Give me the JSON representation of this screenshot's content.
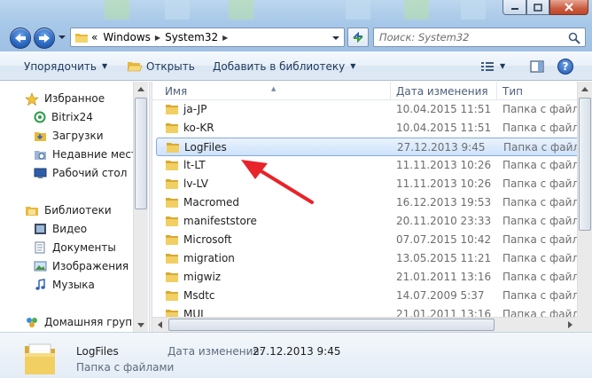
{
  "window": {
    "controls": {
      "minimize": "minimize",
      "maximize": "maximize",
      "close": "close"
    }
  },
  "address": {
    "overflow": "«",
    "crumbs": [
      "Windows",
      "System32"
    ]
  },
  "search": {
    "placeholder": "Поиск: System32"
  },
  "toolbar": {
    "organize": "Упорядочить",
    "open": "Открыть",
    "add_to_library": "Добавить в библиотеку"
  },
  "sidebar": {
    "favorites": {
      "label": "Избранное",
      "items": [
        "Bitrix24",
        "Загрузки",
        "Недавние места",
        "Рабочий стол"
      ]
    },
    "libraries": {
      "label": "Библиотеки",
      "items": [
        "Видео",
        "Документы",
        "Изображения",
        "Музыка"
      ]
    },
    "homegroup": {
      "label": "Домашняя группа"
    }
  },
  "columns": {
    "name": "Имя",
    "date": "Дата изменения",
    "type": "Тип"
  },
  "files": [
    {
      "name": "ja-JP",
      "date": "10.04.2015 11:51",
      "type": "Папка с файлами"
    },
    {
      "name": "ko-KR",
      "date": "10.04.2015 11:51",
      "type": "Папка с файлами"
    },
    {
      "name": "LogFiles",
      "date": "27.12.2013 9:45",
      "type": "Папка с файлами"
    },
    {
      "name": "lt-LT",
      "date": "11.11.2013 10:26",
      "type": "Папка с файлами"
    },
    {
      "name": "lv-LV",
      "date": "11.11.2013 10:26",
      "type": "Папка с файлами"
    },
    {
      "name": "Macromed",
      "date": "16.12.2013 19:53",
      "type": "Папка с файлами"
    },
    {
      "name": "manifeststore",
      "date": "20.11.2010 23:33",
      "type": "Папка с файлами"
    },
    {
      "name": "Microsoft",
      "date": "07.07.2015 10:42",
      "type": "Папка с файлами"
    },
    {
      "name": "migration",
      "date": "13.05.2015 11:21",
      "type": "Папка с файлами"
    },
    {
      "name": "migwiz",
      "date": "21.01.2011 13:16",
      "type": "Папка с файлами"
    },
    {
      "name": "Msdtc",
      "date": "14.07.2009 5:37",
      "type": "Папка с файлами"
    },
    {
      "name": "MUI",
      "date": "21.01.2011 13:16",
      "type": "Папка с файлами"
    }
  ],
  "selected_index": 2,
  "details": {
    "name": "LogFiles",
    "type": "Папка с файлами",
    "date_label": "Дата изменения:",
    "date_value": "27.12.2013 9:45"
  },
  "colors": {
    "accent": "#2c6ac4",
    "selection": "#cde2fb",
    "annotation": "#e8232a",
    "folder": "#f2c94c"
  }
}
